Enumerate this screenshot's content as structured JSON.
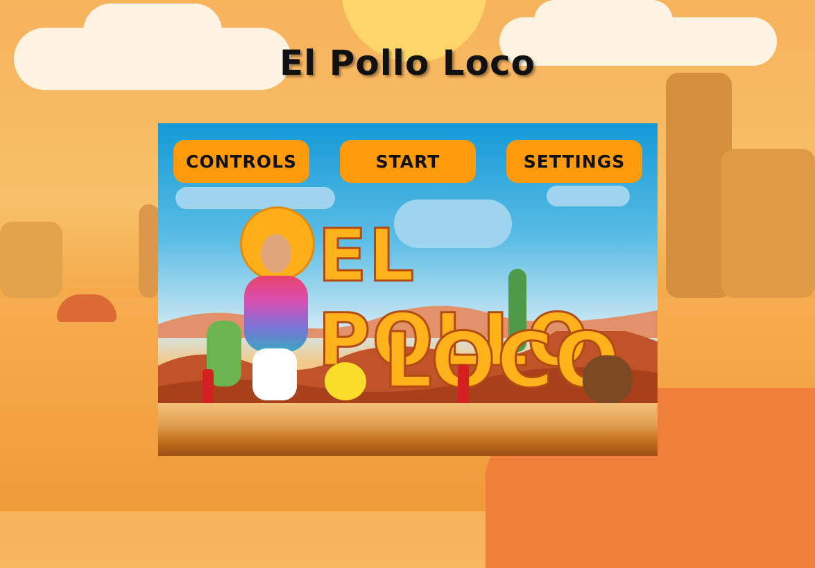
{
  "page": {
    "title": "El Pollo Loco"
  },
  "menu": {
    "controls_label": "CONTROLS",
    "start_label": "START",
    "settings_label": "SETTINGS"
  },
  "splash": {
    "logo_line1": "EL POLLO",
    "logo_line2": "LOCO"
  },
  "colors": {
    "button": "#ff9a0a",
    "sky": "#1499d6",
    "logo": "#ffb21a"
  }
}
